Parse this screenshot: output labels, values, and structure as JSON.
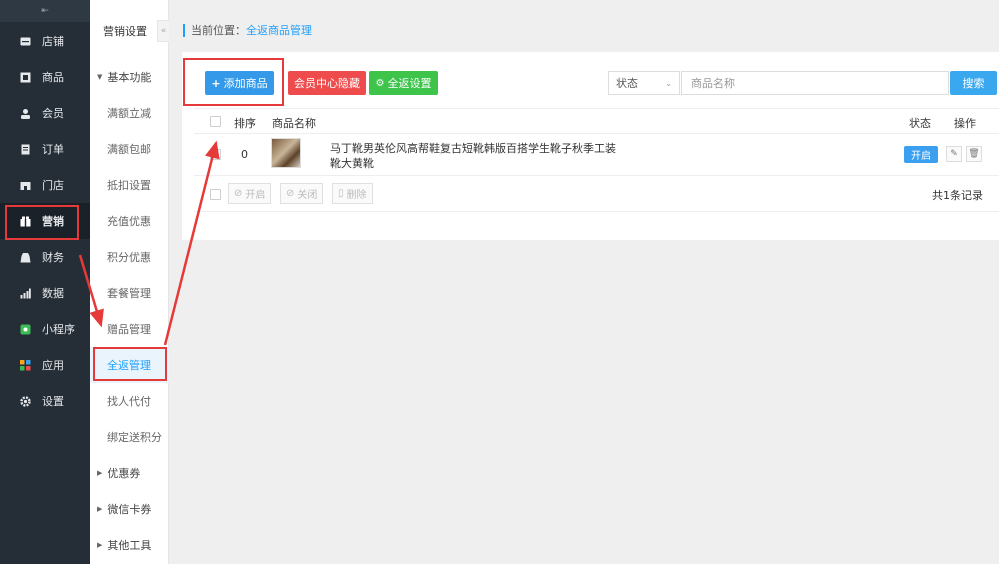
{
  "nav": {
    "collapse_glyph": "⇤",
    "items": [
      {
        "label": "店铺",
        "icon": "store-icon"
      },
      {
        "label": "商品",
        "icon": "goods-icon"
      },
      {
        "label": "会员",
        "icon": "member-icon"
      },
      {
        "label": "订单",
        "icon": "order-icon"
      },
      {
        "label": "门店",
        "icon": "shop-icon"
      },
      {
        "label": "营销",
        "icon": "gift-icon",
        "active": true
      },
      {
        "label": "财务",
        "icon": "finance-icon"
      },
      {
        "label": "数据",
        "icon": "chart-icon"
      },
      {
        "label": "小程序",
        "icon": "miniprogram-icon"
      },
      {
        "label": "应用",
        "icon": "apps-icon"
      },
      {
        "label": "设置",
        "icon": "gear-icon"
      }
    ]
  },
  "subnav": {
    "title": "营销设置",
    "collapse_glyph": "«",
    "group_basic": "基本功能",
    "items": [
      "满额立减",
      "满额包邮",
      "抵扣设置",
      "充值优惠",
      "积分优惠",
      "套餐管理",
      "赠品管理",
      "全返管理",
      "找人代付",
      "绑定送积分"
    ],
    "active_item": "全返管理",
    "groups": [
      "优惠券",
      "微信卡券",
      "其他工具"
    ]
  },
  "breadcrumb": {
    "prefix": "当前位置：",
    "current": "全返商品管理"
  },
  "toolbar": {
    "add_label": "添加商品",
    "hide_label": "会员中心隐藏",
    "settings_label": "全返设置",
    "status_label": "状态",
    "search_placeholder": "商品名称",
    "search_button": "搜索"
  },
  "table": {
    "headers": {
      "sort": "排序",
      "name": "商品名称",
      "status": "状态",
      "ops": "操作"
    },
    "rows": [
      {
        "sort": "0",
        "name": "马丁靴男英伦风高帮鞋复古短靴韩版百搭学生靴子秋季工装靴大黄靴",
        "status": "开启"
      }
    ]
  },
  "footer": {
    "enable_label": "开启",
    "disable_label": "关闭",
    "delete_label": "删除",
    "total": "共1条记录"
  },
  "colors": {
    "nav_bg": "#252d36",
    "accent": "#1e9fff",
    "add_btn": "#3399e8",
    "hide_btn": "#ee4c4c",
    "settings_btn": "#3ec34b",
    "annotation": "#e63939"
  }
}
